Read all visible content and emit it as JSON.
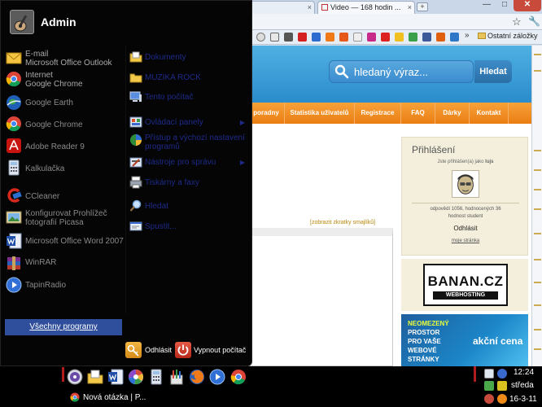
{
  "browser": {
    "tabs": [
      {
        "label": "",
        "close": "×"
      },
      {
        "label": "Video — 168 hodin ...",
        "close": "×"
      }
    ],
    "new_tab": "+",
    "window_controls": {
      "minimize": "—",
      "maximize": "□",
      "close": "✕"
    },
    "bookmarks_more": "»",
    "bookmarks_folder": "Ostatní záložky"
  },
  "site": {
    "search_placeholder": "hledaný výraz...",
    "search_button": "Hledat",
    "nav": [
      "poradny",
      "Statistika uživatelů",
      "Registrace",
      "FAQ",
      "Dárky",
      "Kontakt"
    ],
    "emoticon_link": "[zobrazit zkratky smajlíků]",
    "login": {
      "title": "Přihlášení",
      "subtitle_prefix": "Jste přihlášen(a) jako ",
      "username": "lujs",
      "stats_line1": "odpovědí 1056, hodnocených 36",
      "stats_line2": "hodnost student",
      "logout": "Odhlásit",
      "my_page": "moje stránka"
    },
    "ad1": {
      "brand": "BANAN.CZ",
      "sub": "WEBHOSTING"
    },
    "ad2": {
      "l1": "NEOMEZENÝ",
      "l2": "PROSTOR",
      "l3": "PRO VAŠE",
      "l4": "WEBOVÉ",
      "l5": "STRÁNKY",
      "price": "akční cena"
    }
  },
  "startmenu": {
    "user": "Admin",
    "pinned": [
      {
        "label": "E-mail",
        "sub": "Microsoft Office Outlook",
        "icon": "email-icon"
      },
      {
        "label": "Internet",
        "sub": "Google Chrome",
        "icon": "chrome-icon"
      }
    ],
    "recent": [
      "Google Earth",
      "Google Chrome",
      "Adobe Reader 9",
      "Kalkulačka",
      "CCleaner",
      "Konfigurovat Prohlížeč fotografií Picasa",
      "Microsoft Office Word 2007",
      "WinRAR",
      "TapinRadio"
    ],
    "right": [
      "Dokumenty",
      "MUZIKA ROCK",
      "Tento počítač",
      "Ovládací panely",
      "Přístup a výchozí nastavení programů",
      "Nástroje pro správu",
      "Tiskárny a faxy",
      "Hledat",
      "Spustit..."
    ],
    "all_programs": "Všechny programy",
    "logoff": "Odhlásit",
    "shutdown": "Vypnout počítač"
  },
  "taskbar": {
    "task": "Nová otázka | P...",
    "time": "12:24",
    "day": "středa",
    "date": "16-3-11"
  }
}
